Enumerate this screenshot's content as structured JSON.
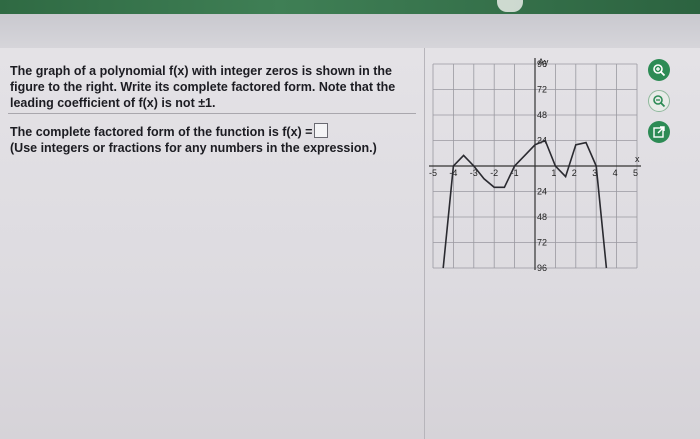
{
  "question": {
    "prompt": "The graph of a polynomial f(x) with integer zeros is shown in the figure to the right. Write its complete factored form. Note that the leading coefficient of f(x) is not ±1.",
    "answer_label": "The complete factored form of the function is f(x) =",
    "instruction": "(Use integers or fractions for any numbers in the expression.)"
  },
  "tools": [
    "zoom-in-icon",
    "zoom-out-icon",
    "open-external-icon"
  ],
  "graph": {
    "y_axis_label": "Ay",
    "x_axis_label": "x",
    "y_ticks": [
      "96",
      "72",
      "48",
      "24",
      "24",
      "48",
      "72",
      "96"
    ],
    "x_ticks": [
      "-5",
      "-4",
      "-3",
      "-2",
      "-1",
      "1",
      "2",
      "3",
      "4",
      "5"
    ],
    "colors": {
      "curve": "#2a2a30",
      "grid": "#9a99a0",
      "accent": "#2d8b55"
    }
  },
  "chart_data": {
    "type": "line",
    "x": [
      -4.5,
      -4,
      -3.5,
      -3,
      -2.5,
      -2,
      -1.5,
      -1,
      -0.5,
      0,
      0.5,
      1,
      1.5,
      2,
      2.5,
      3,
      3.5
    ],
    "y": [
      -96,
      0,
      10,
      0,
      -12,
      -20,
      -20,
      0,
      10,
      20,
      24,
      0,
      -10,
      20,
      22,
      0,
      -96
    ],
    "xlim": [
      -5,
      5
    ],
    "ylim": [
      -96,
      96
    ],
    "xlabel": "x",
    "ylabel": "y",
    "grid": true
  }
}
